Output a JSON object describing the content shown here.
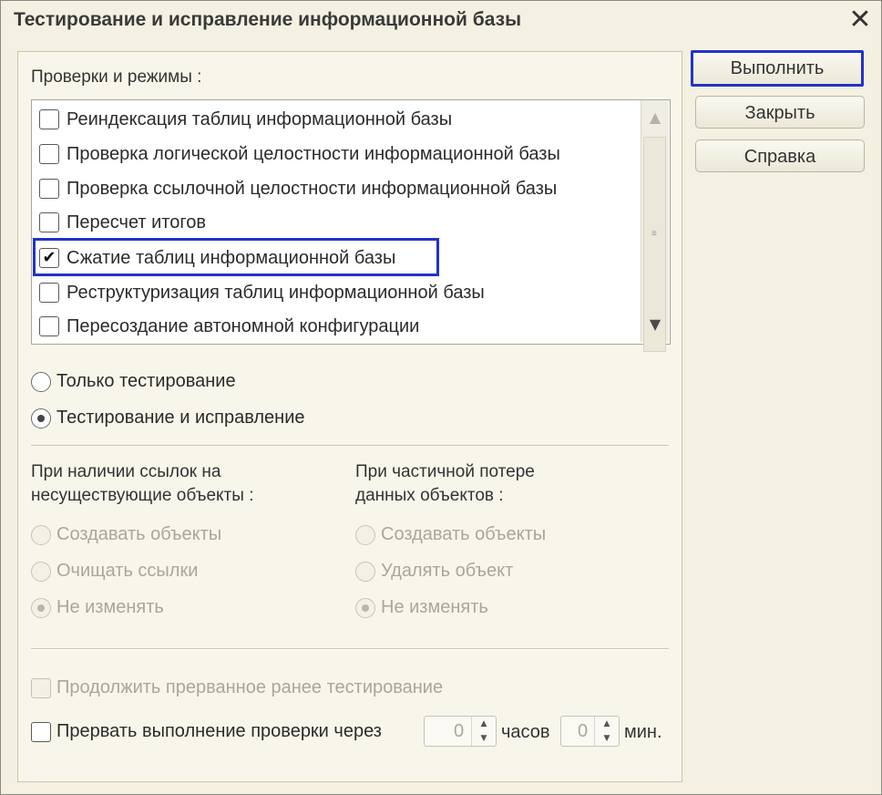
{
  "window": {
    "title": "Тестирование и исправление информационной базы",
    "close_glyph": "✕"
  },
  "checks": {
    "label": "Проверки и режимы :",
    "items": [
      {
        "label": "Реиндексация таблиц информационной базы",
        "checked": false
      },
      {
        "label": "Проверка логической целостности информационной базы",
        "checked": false
      },
      {
        "label": "Проверка ссылочной целостности информационной базы",
        "checked": false
      },
      {
        "label": "Пересчет итогов",
        "checked": false
      },
      {
        "label": "Сжатие таблиц информационной базы",
        "checked": true
      },
      {
        "label": "Реструктуризация таблиц информационной базы",
        "checked": false
      },
      {
        "label": "Пересоздание автономной конфигурации",
        "checked": false
      }
    ]
  },
  "mode": {
    "options": [
      {
        "label": "Только тестирование",
        "selected": false
      },
      {
        "label": "Тестирование и исправление",
        "selected": true
      }
    ]
  },
  "refs": {
    "label_line1": "При наличии ссылок на",
    "label_line2": "несуществующие объекты :",
    "options": [
      {
        "label": "Создавать объекты",
        "selected": false
      },
      {
        "label": "Очищать ссылки",
        "selected": false
      },
      {
        "label": "Не изменять",
        "selected": true
      }
    ]
  },
  "partial": {
    "label_line1": "При частичной потере",
    "label_line2": "данных объектов :",
    "options": [
      {
        "label": "Создавать объекты",
        "selected": false
      },
      {
        "label": "Удалять объект",
        "selected": false
      },
      {
        "label": "Не изменять",
        "selected": true
      }
    ]
  },
  "continue_label": "Продолжить прерванное ранее тестирование",
  "interrupt": {
    "label": "Прервать выполнение проверки через",
    "hours_value": "0",
    "hours_unit": "часов",
    "minutes_value": "0",
    "minutes_unit": "мин."
  },
  "buttons": {
    "run": "Выполнить",
    "close": "Закрыть",
    "help": "Справка"
  },
  "colors": {
    "highlight": "#2233c9",
    "background": "#f4f1e2"
  }
}
